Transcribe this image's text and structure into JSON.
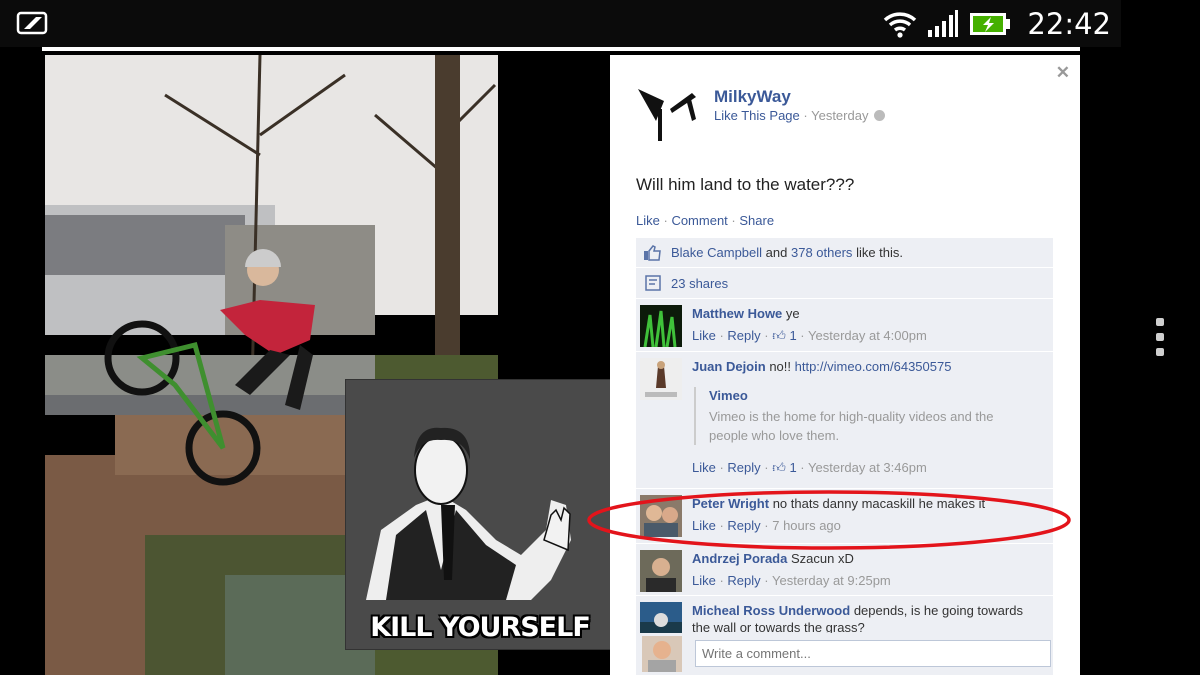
{
  "status_bar": {
    "time": "22:42",
    "icons": [
      "photo-notification-icon",
      "wifi-icon",
      "signal-icon",
      "battery-charging-icon"
    ]
  },
  "meme": {
    "caption": "KILL YOURSELF"
  },
  "post": {
    "page_name": "MilkyWay",
    "like_page": "Like This Page",
    "time": "Yesterday",
    "text": "Will him land to the water???",
    "actions": {
      "like": "Like",
      "comment": "Comment",
      "share": "Share"
    }
  },
  "likes": {
    "name": "Blake Campbell",
    "and": "and",
    "others": "378 others",
    "suffix": "like this."
  },
  "shares": {
    "label": "23 shares"
  },
  "comments": [
    {
      "name": "Matthew Howe",
      "text": "ye",
      "like": "Like",
      "reply": "Reply",
      "likes": "1",
      "time": "Yesterday at 4:00pm"
    },
    {
      "name": "Juan Dejoin",
      "text": "no!!",
      "link": "http://vimeo.com/64350575",
      "share_title": "Vimeo",
      "share_desc": "Vimeo is the home for high-quality videos and the people who love them.",
      "like": "Like",
      "reply": "Reply",
      "likes": "1",
      "time": "Yesterday at 3:46pm"
    },
    {
      "name": "Peter Wright",
      "text": "no thats danny macaskill he makes it",
      "like": "Like",
      "reply": "Reply",
      "time": "7 hours ago"
    },
    {
      "name": "Andrzej Porada",
      "text": "Szacun xD",
      "like": "Like",
      "reply": "Reply",
      "time": "Yesterday at 9:25pm"
    },
    {
      "name": "Micheal Ross Underwood",
      "text": "depends, is he going towards the wall or towards the grass?"
    }
  ],
  "write_comment": {
    "placeholder": "Write a comment..."
  },
  "colors": {
    "facebook_blue": "#3b5998",
    "ufi_bg": "#edeff4",
    "annotation_red": "#e3141b"
  }
}
